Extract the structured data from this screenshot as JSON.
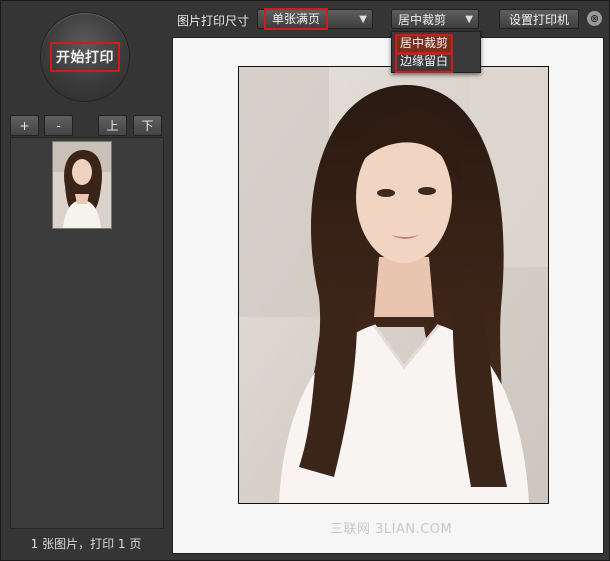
{
  "left": {
    "start_label": "开始打印",
    "buttons": {
      "add": "+",
      "remove": "-",
      "up": "上",
      "down": "下"
    },
    "status": "1 张图片，打印 1 页"
  },
  "toolbar": {
    "size_label": "图片打印尺寸",
    "size_value": "单张满页",
    "crop_value": "居中裁剪",
    "printer_button": "设置打印机",
    "close": "⊗"
  },
  "dropdown": {
    "options": [
      "居中裁剪",
      "边缘留白"
    ],
    "selected": "居中裁剪"
  },
  "preview": {
    "watermark": "三联网 3LIAN.COM"
  },
  "colors": {
    "accent_red": "#d01b1b",
    "panel": "#353535",
    "preview_bg": "#f6f6f6"
  }
}
